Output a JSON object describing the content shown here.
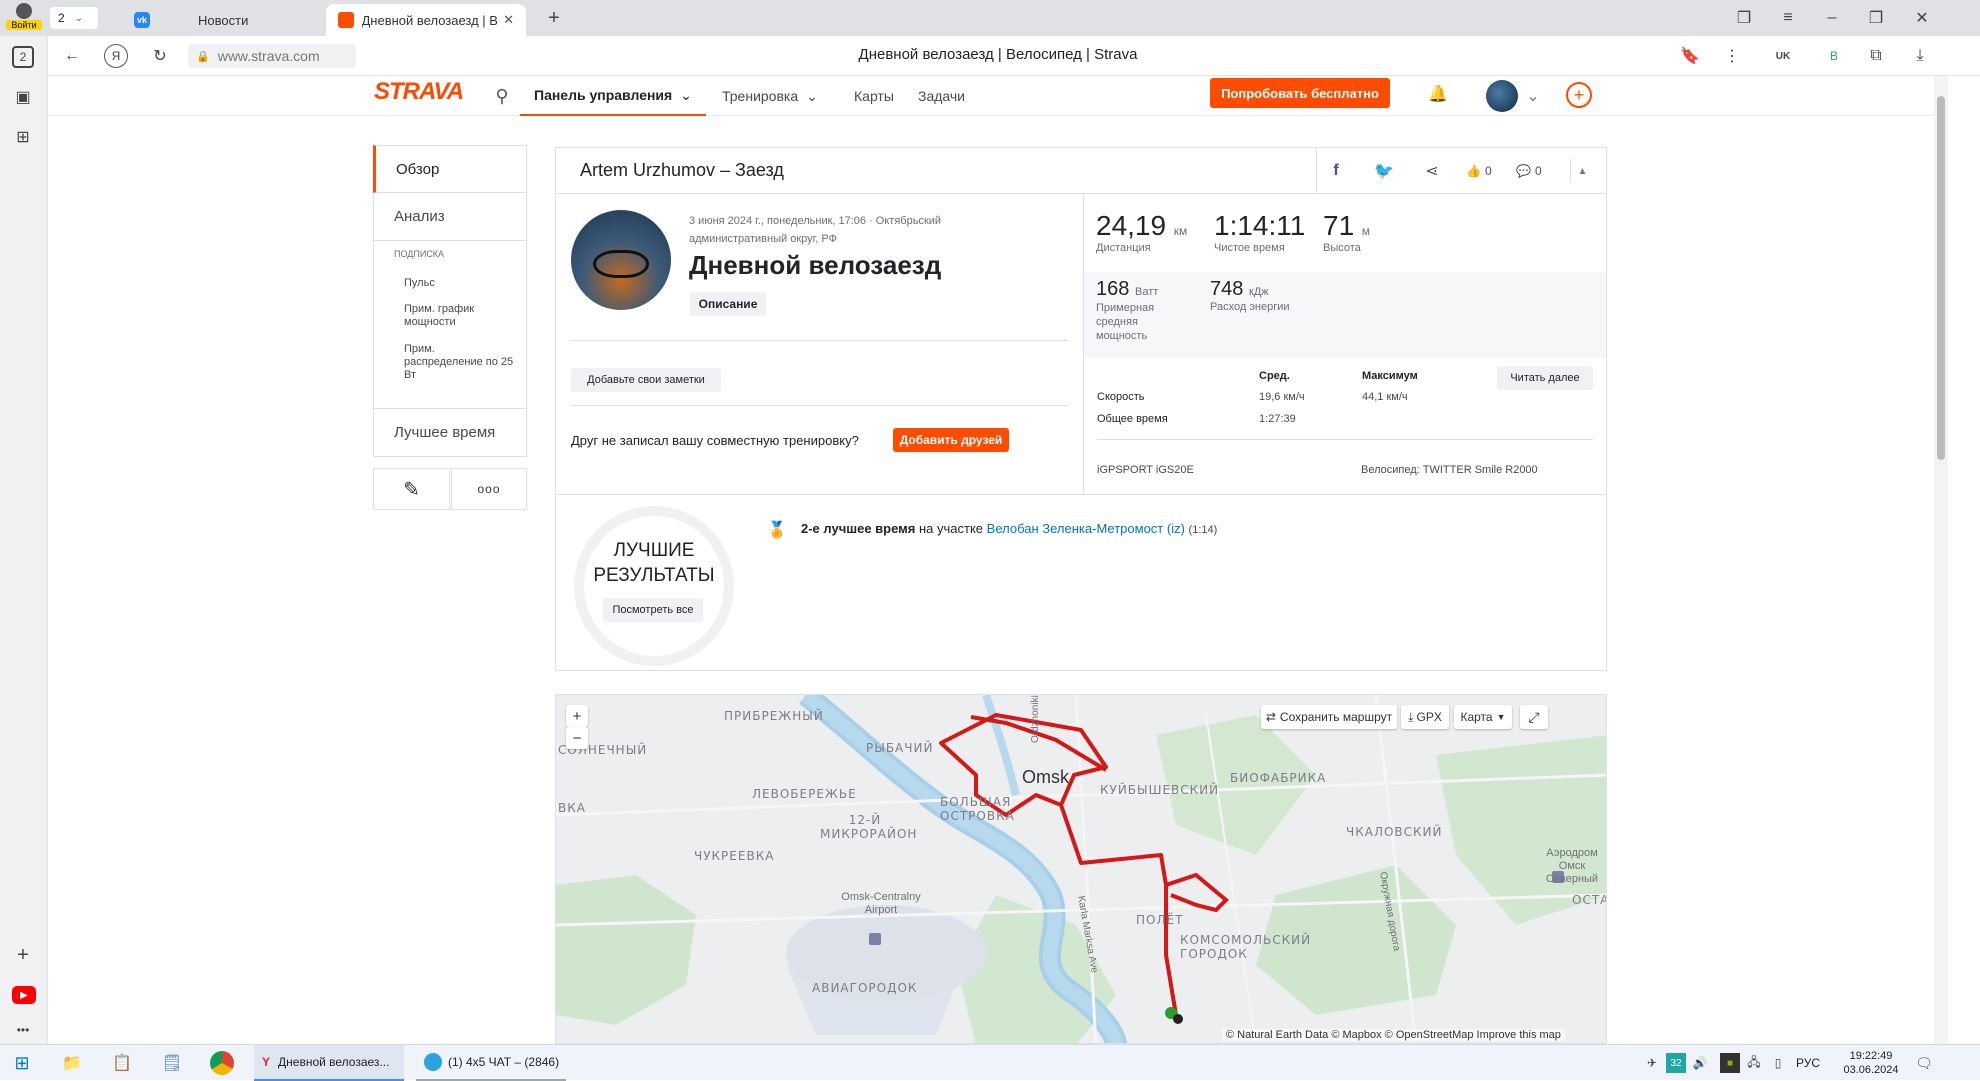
{
  "browser": {
    "login_label": "Войти",
    "tab_count": "2",
    "tabs": [
      {
        "title": "Новости"
      },
      {
        "title": "Дневной велозаезд | В"
      }
    ],
    "address": "www.strava.com",
    "page_title": "Дневной велозаезд | Велосипед | Strava",
    "rail_badge": "2"
  },
  "strava_nav": {
    "logo": "STRAVA",
    "dashboard": "Панель управления",
    "training": "Тренировка",
    "maps": "Карты",
    "challenges": "Задачи",
    "trial_button": "Попробовать бесплатно"
  },
  "sidebar": {
    "overview": "Обзор",
    "analysis": "Анализ",
    "subscription_header": "ПОДПИСКА",
    "sub_items": [
      "Пульс",
      "Прим. график мощности",
      "Прим. распределение по 25 Вт"
    ],
    "best_times": "Лучшее время"
  },
  "activity": {
    "header": "Artem Urzhumov – Заезд",
    "kudos_count": "0",
    "comments_count": "0",
    "date_location": "3 июня 2024 г., понедельник, 17:06 · Октябрьский административный округ, РФ",
    "title": "Дневной велозаезд",
    "description_button": "Описание",
    "add_notes": "Добавьте свои заметки",
    "friend_prompt": "Друг не записал вашу совместную тренировку?",
    "add_friends": "Добавить друзей"
  },
  "stats": {
    "distance_value": "24,19",
    "distance_unit": "км",
    "distance_label": "Дистанция",
    "moving_time_value": "1:14:11",
    "moving_time_label": "Чистое время",
    "elevation_value": "71",
    "elevation_unit": "м",
    "elevation_label": "Высота",
    "power_value": "168",
    "power_unit": "Ватт",
    "power_label": "Примерная средняя мощность",
    "energy_value": "748",
    "energy_unit": "кДж",
    "energy_label": "Расход энергии",
    "col_avg": "Сред.",
    "col_max": "Максимум",
    "read_more": "Читать далее",
    "speed_label": "Скорость",
    "speed_avg": "19,6 км/ч",
    "speed_max": "44,1 км/ч",
    "elapsed_label": "Общее время",
    "elapsed_value": "1:27:39",
    "device": "iGPSPORT iGS20E",
    "bike": "Велосипед: TWITTER Smile R2000"
  },
  "achievements": {
    "badge_line1": "ЛУЧШИЕ",
    "badge_line2": "РЕЗУЛЬТАТЫ",
    "view_all": "Посмотреть все",
    "rank_text": "2-е лучшее время",
    "on_segment": "на участке",
    "segment_name": "Велобан Зеленка-Метромост (iz)",
    "segment_time": "(1:14)"
  },
  "map": {
    "zoom_in": "+",
    "zoom_out": "−",
    "save_route": "Сохранить маршрут",
    "gpx": "GPX",
    "map_type": "Карта",
    "labels": {
      "omsk": "Omsk",
      "prib": "ПРИБРЕЖНЫЙ",
      "solnech": "СОЛНЕЧНЫЙ",
      "rybachiy": "РЫБАЧИЙ",
      "leviy": "ЛЕВОБЕРЕЖЬЕ",
      "kuyb": "КУЙБЫШЕВСКИЙ",
      "biofab": "БИОФАБРИКА",
      "bolshaya": "БОЛЬШАЯ ОСТРОВКА",
      "mikro": "12-Й МИКРОРАЙОН",
      "chukreev": "ЧУКРЕЕВКА",
      "chkalov": "ЧКАЛОВСКИЙ",
      "airport": "Omsk-Centralny Airport",
      "aerodrom": "Аэродром Омск Северный",
      "aviagor": "АВИАГОРОДОК",
      "komsom": "КОМСОМОЛЬСКИЙ ГОРОДОК",
      "polet": "ПОЛЁТ",
      "vka": "ВКА",
      "ostash": "ОСТАШ",
      "ordzh": "Ordzhonikid",
      "marksa": "Karla Marksa Ave",
      "okruzh": "Окружная дорога"
    },
    "attribution": "© Natural Earth Data © Mapbox © OpenStreetMap Improve this map"
  },
  "taskbar": {
    "app1": "Дневной велозаез...",
    "app2": "(1) 4x5 ЧАТ – (2846)",
    "lang": "РУС",
    "time": "19:22:49",
    "date": "03.06.2024"
  }
}
